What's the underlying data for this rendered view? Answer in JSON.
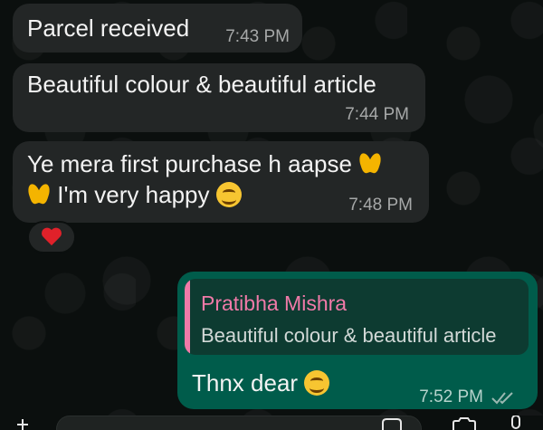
{
  "messages": [
    {
      "text": "Parcel received",
      "time": "7:43 PM"
    },
    {
      "text": "Beautiful colour & beautiful article",
      "time": "7:44 PM"
    },
    {
      "line1": "Ye mera first purchase h aapse",
      "line2": "I'm very happy",
      "time": "7:48 PM",
      "reaction": "heart-emoji"
    }
  ],
  "reply": {
    "quoted_name": "Pratibha Mishra",
    "quoted_text": "Beautiful colour & beautiful article",
    "text": "Thnx dear",
    "time": "7:52 PM"
  },
  "colors": {
    "incoming_bubble": "#232626",
    "outgoing_bubble": "#005c4b",
    "quote_accent": "#f07aa8"
  }
}
